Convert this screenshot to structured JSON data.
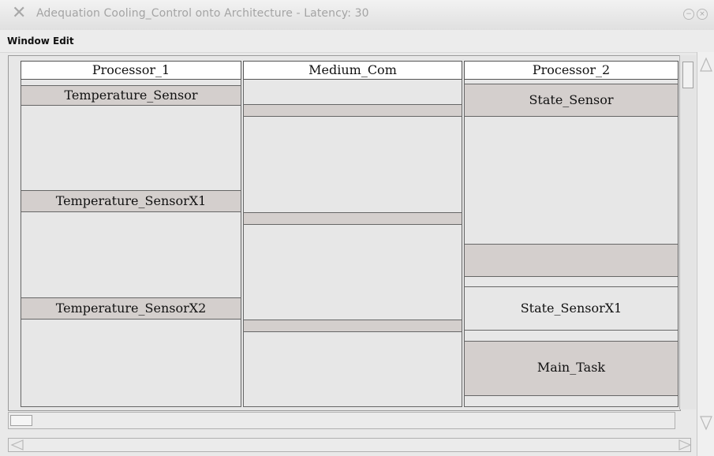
{
  "window": {
    "title": "Adequation Cooling_Control onto Architecture - Latency: 30"
  },
  "menu": {
    "items": [
      "Window",
      "Edit"
    ]
  },
  "columns": [
    {
      "header": "Processor_1",
      "blocks": [
        "Temperature_Sensor",
        "Temperature_SensorX1",
        "Temperature_SensorX2"
      ]
    },
    {
      "header": "Medium_Com",
      "blocks": [
        "",
        "",
        ""
      ]
    },
    {
      "header": "Processor_2",
      "blocks": [
        "State_Sensor",
        "",
        "State_SensorX1",
        "Main_Task"
      ]
    }
  ],
  "icons": [
    "close-x-icon",
    "minimize-icon",
    "close-icon",
    "scroll-up-arrow-icon",
    "scroll-down-arrow-icon",
    "scroll-left-arrow-icon",
    "scroll-right-arrow-icon"
  ]
}
